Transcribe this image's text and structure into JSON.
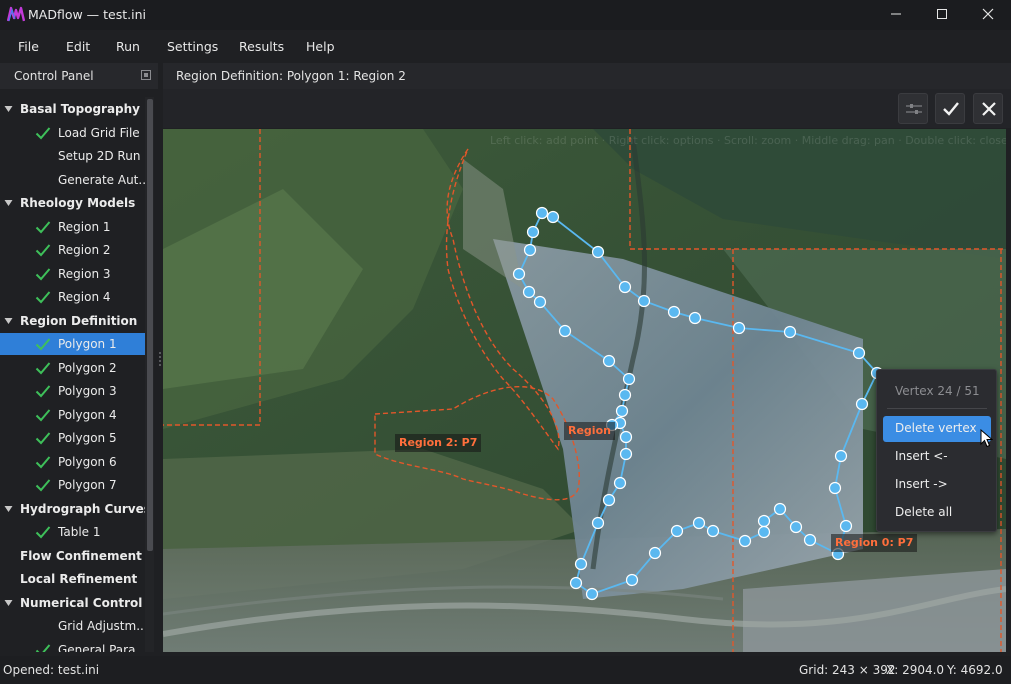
{
  "window": {
    "title": "MADflow — test.ini"
  },
  "menu": [
    "File",
    "Edit",
    "Run",
    "Settings",
    "Results",
    "Help"
  ],
  "panel": {
    "title": "Control Panel"
  },
  "tree": [
    {
      "label": "Basal Topography",
      "bold": true,
      "expanded": true,
      "checked": false
    },
    {
      "label": "Load Grid File",
      "bold": false,
      "checked": true
    },
    {
      "label": "Setup 2D Run",
      "bold": false,
      "checked": false
    },
    {
      "label": "Generate Aut...",
      "bold": false,
      "checked": false
    },
    {
      "label": "Rheology Models",
      "bold": true,
      "expanded": true,
      "checked": false
    },
    {
      "label": "Region 1",
      "bold": false,
      "checked": true
    },
    {
      "label": "Region 2",
      "bold": false,
      "checked": true
    },
    {
      "label": "Region 3",
      "bold": false,
      "checked": true
    },
    {
      "label": "Region 4",
      "bold": false,
      "checked": true
    },
    {
      "label": "Region Definition",
      "bold": true,
      "expanded": true,
      "checked": false
    },
    {
      "label": "Polygon 1",
      "bold": false,
      "checked": true,
      "selected": true
    },
    {
      "label": "Polygon 2",
      "bold": false,
      "checked": true
    },
    {
      "label": "Polygon 3",
      "bold": false,
      "checked": true
    },
    {
      "label": "Polygon 4",
      "bold": false,
      "checked": true
    },
    {
      "label": "Polygon 5",
      "bold": false,
      "checked": true
    },
    {
      "label": "Polygon 6",
      "bold": false,
      "checked": true
    },
    {
      "label": "Polygon 7",
      "bold": false,
      "checked": true
    },
    {
      "label": "Hydrograph Curves",
      "bold": true,
      "expanded": true,
      "checked": false
    },
    {
      "label": "Table 1",
      "bold": false,
      "checked": true
    },
    {
      "label": "Flow Confinement",
      "bold": true,
      "expanded": false,
      "checked": false,
      "noarrow": true
    },
    {
      "label": "Local Refinement",
      "bold": true,
      "expanded": false,
      "checked": false,
      "noarrow": true
    },
    {
      "label": "Numerical Control",
      "bold": true,
      "expanded": true,
      "checked": false
    },
    {
      "label": "Grid Adjustm...",
      "bold": false,
      "checked": false
    },
    {
      "label": "General Para...",
      "bold": false,
      "checked": true
    }
  ],
  "region_header": "Region Definition: Polygon 1: Region 2",
  "map": {
    "info_line": "Left click: add point · Right click: options · Scroll: zoom · Middle drag: pan · Double click: close",
    "labels": {
      "region2": "Region 2: P7",
      "region_center": "Region",
      "region0": "Region 0: P7"
    }
  },
  "context_menu": {
    "title": "Vertex 24 / 51",
    "items": [
      "Delete vertex",
      "Insert <-",
      "Insert ->",
      "Delete all"
    ],
    "active_index": 0
  },
  "status": {
    "left": "Opened: test.ini",
    "grid": "Grid: 243 × 392",
    "x": "X: 2904.0",
    "y": "Y: 4692.0"
  },
  "colors": {
    "accent": "#3b8de4",
    "selection": "#2f7fd8",
    "polygon": "#5ab8f0",
    "region_line": "#e2572a",
    "check": "#3ec05a"
  },
  "icons": {
    "toolbar": [
      "adjust-icon",
      "check-icon",
      "close-icon"
    ]
  }
}
